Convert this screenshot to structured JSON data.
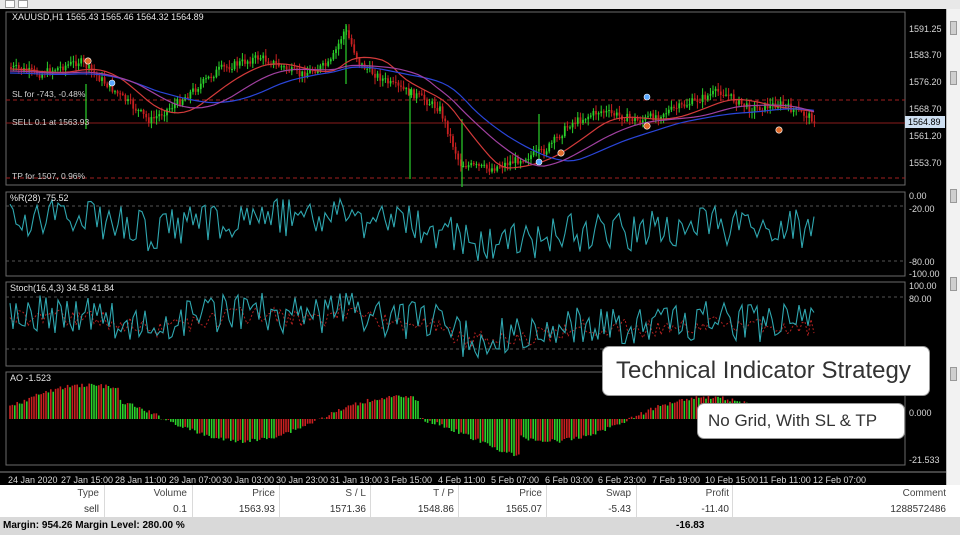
{
  "chart": {
    "symbol_header": "XAUUSD,H1  1565.43 1565.46 1564.32 1564.89",
    "price_axis": [
      "1591.25",
      "1583.70",
      "1576.20",
      "1568.70",
      "1561.20",
      "1553.70"
    ],
    "current_price": "1564.89",
    "trade_lines": {
      "sl_label": "SL for -743, -0.48%",
      "sell_label": "SELL 0.1 at 1563.93",
      "tp_label": "TP for 1507, 0.96%"
    },
    "wr_label": "%R(28) -75.52",
    "wr_axis": [
      "0.00",
      "-20.00",
      "-80.00",
      "-100.00"
    ],
    "stoch_label": "Stoch(16,4,3) 34.58 41.84",
    "stoch_axis": [
      "100.00",
      "80.00"
    ],
    "ao_label": "AO -1.523",
    "ao_axis": [
      "0.000",
      "-21.533"
    ],
    "time_axis": [
      "24 Jan 2020",
      "27 Jan 15:00",
      "28 Jan 11:00",
      "29 Jan 07:00",
      "30 Jan 03:00",
      "30 Jan 23:00",
      "31 Jan 19:00",
      "3 Feb 15:00",
      "4 Feb 11:00",
      "5 Feb 07:00",
      "6 Feb 03:00",
      "6 Feb 23:00",
      "7 Feb 19:00",
      "10 Feb 15:00",
      "11 Feb 11:00",
      "12 Feb 07:00"
    ],
    "colors": {
      "bull": "#2bd12b",
      "bear": "#c82020",
      "trade_line": "#8a1d1d",
      "wr_line": "#2fa7b0",
      "stoch_main": "#2fa7b0",
      "stoch_signal": "#b02020",
      "ma_red": "#d23a3a",
      "ma_blue": "#2a45d8",
      "ma_purple": "#a040a0"
    }
  },
  "callouts": {
    "title": "Technical Indicator Strategy",
    "subtitle": "No Grid, With SL & TP"
  },
  "table": {
    "headers": [
      "Type",
      "Volume",
      "Price",
      "S / L",
      "T / P",
      "Price",
      "Swap",
      "Profit",
      "Comment"
    ],
    "row": [
      "sell",
      "0.1",
      "1563.93",
      "1571.36",
      "1548.86",
      "1565.07",
      "-5.43",
      "-11.40",
      "1288572486"
    ],
    "footer_text": "Margin: 954.26  Margin Level: 280.00 %",
    "footer_total": "-16.83"
  }
}
